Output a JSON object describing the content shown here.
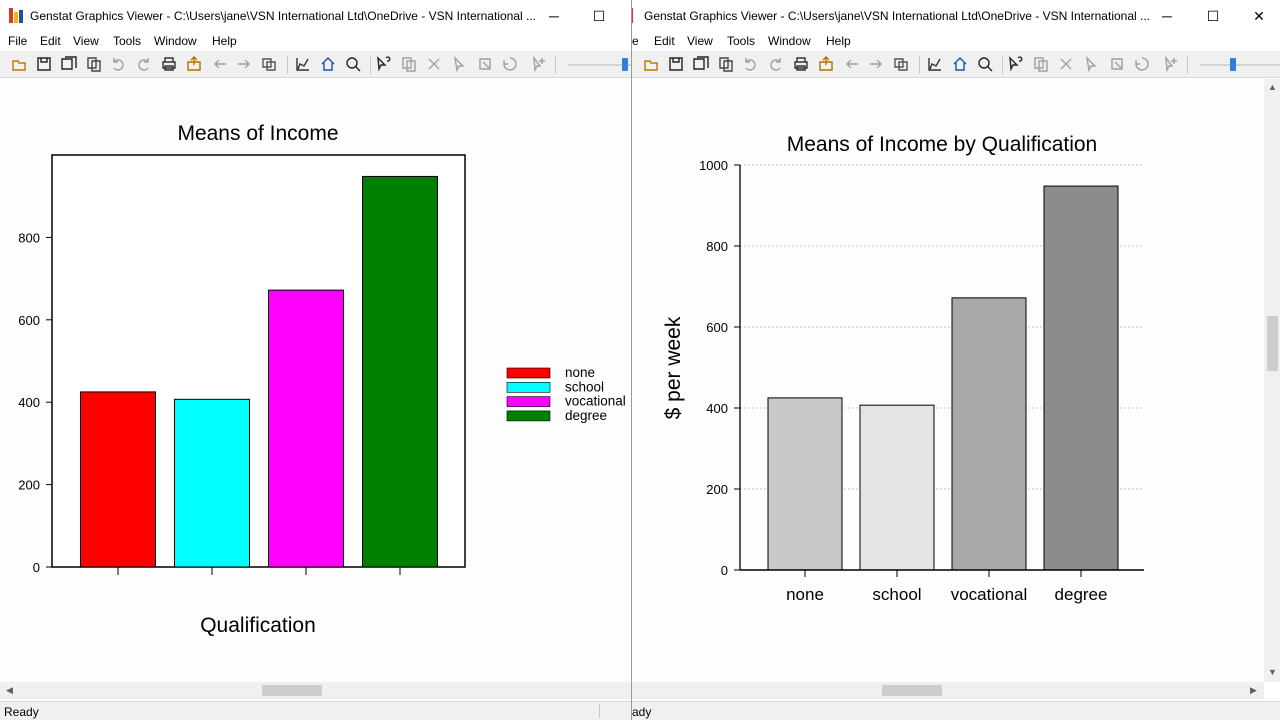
{
  "windows": [
    {
      "title": "Genstat Graphics Viewer - C:\\Users\\jane\\VSN International Ltd\\OneDrive - VSN International ...",
      "menu": [
        "File",
        "Edit",
        "View",
        "Tools",
        "Window",
        "Help"
      ],
      "status": "Ready"
    },
    {
      "title": "Genstat Graphics Viewer - C:\\Users\\jane\\VSN International Ltd\\OneDrive - VSN International ...",
      "menu": [
        "e",
        "Edit",
        "View",
        "Tools",
        "Window",
        "Help"
      ],
      "status": "ady"
    }
  ],
  "window_controls": {
    "minimize": "─",
    "maximize": "☐",
    "close": "✕"
  },
  "toolbar_icons": [
    "open-icon",
    "save-icon",
    "save-all-icon",
    "copy-icon",
    "undo-icon",
    "redo-icon",
    "print-icon",
    "export-icon",
    "back-icon",
    "forward-icon",
    "windows-icon",
    "edit-graph-icon",
    "home-icon",
    "zoom-icon",
    "help-pointer-icon",
    "copy-data-icon",
    "delete-icon",
    "pointer-icon",
    "select-icon",
    "rotate-icon",
    "add-icon"
  ],
  "chart_data": [
    {
      "type": "bar",
      "title": "Means of Income",
      "xlabel": "Qualification",
      "ylabel": "",
      "categories": [
        "none",
        "school",
        "vocational",
        "degree"
      ],
      "values": [
        425,
        407,
        672,
        948
      ],
      "colors": [
        "#ff0000",
        "#00ffff",
        "#ff00ff",
        "#008000"
      ],
      "yticks": [
        "0",
        "200",
        "400",
        "600",
        "800"
      ],
      "ylim": [
        0,
        1000
      ],
      "legend": {
        "placement": "right",
        "entries": [
          "none",
          "school",
          "vocational",
          "degree"
        ]
      },
      "grid": false
    },
    {
      "type": "bar",
      "title": "Means of Income by Qualification",
      "xlabel": "",
      "ylabel": "$ per week",
      "categories": [
        "none",
        "school",
        "vocational",
        "degree"
      ],
      "values": [
        425,
        407,
        672,
        948
      ],
      "colors": [
        "#c8c8c8",
        "#e4e4e4",
        "#a8a8a8",
        "#8c8c8c"
      ],
      "yticks": [
        "0",
        "200",
        "400",
        "600",
        "800",
        "1000"
      ],
      "ylim": [
        0,
        1000
      ],
      "grid": true
    }
  ]
}
